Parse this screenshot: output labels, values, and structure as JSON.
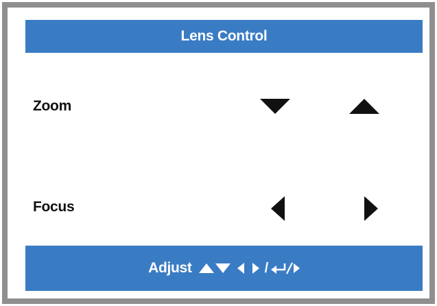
{
  "menu": {
    "title": "Lens Control",
    "items": [
      {
        "label": "Zoom"
      },
      {
        "label": "Focus"
      }
    ]
  },
  "footer": {
    "adjust_label": "Adjust",
    "separator": "/"
  },
  "colors": {
    "bar_blue": "#3a7cc4",
    "frame_gray": "#8f8f8f",
    "text": "#111111"
  },
  "icons": {
    "zoom_decrease": "triangle-down-icon",
    "zoom_increase": "triangle-up-icon",
    "focus_decrease": "triangle-left-icon",
    "focus_increase": "triangle-right-icon"
  }
}
